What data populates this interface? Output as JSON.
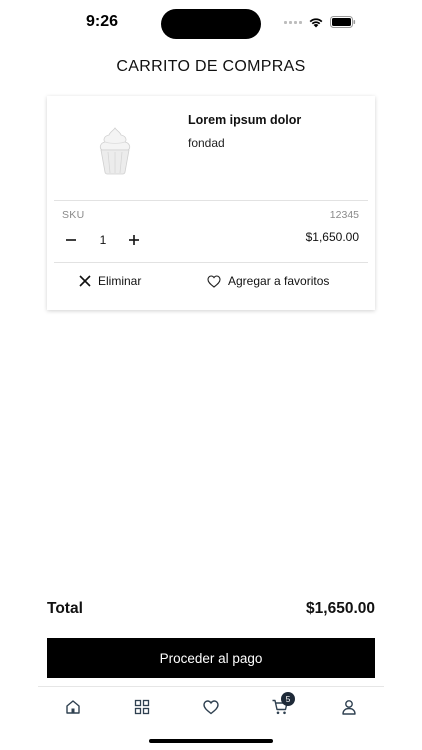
{
  "status_bar": {
    "time": "9:26"
  },
  "header": {
    "title": "CARRITO DE COMPRAS"
  },
  "cart": {
    "items": [
      {
        "name": "Lorem ipsum dolor",
        "subtitle": "fondad",
        "image_icon": "cupcake-icon",
        "sku_label": "SKU",
        "sku_value": "12345",
        "quantity": "1",
        "price": "$1,650.00",
        "remove_label": "Eliminar",
        "favorite_label": "Agregar a favoritos"
      }
    ]
  },
  "summary": {
    "total_label": "Total",
    "total_value": "$1,650.00"
  },
  "checkout": {
    "label": "Proceder al pago"
  },
  "tabbar": {
    "items": [
      {
        "icon": "home-icon"
      },
      {
        "icon": "grid-icon"
      },
      {
        "icon": "heart-icon"
      },
      {
        "icon": "cart-icon",
        "badge": "5"
      },
      {
        "icon": "user-icon"
      }
    ]
  },
  "colors": {
    "primary": "#000000",
    "badge": "#1e2a38",
    "divider": "#e2e2e2",
    "muted": "#8a8a8a"
  }
}
